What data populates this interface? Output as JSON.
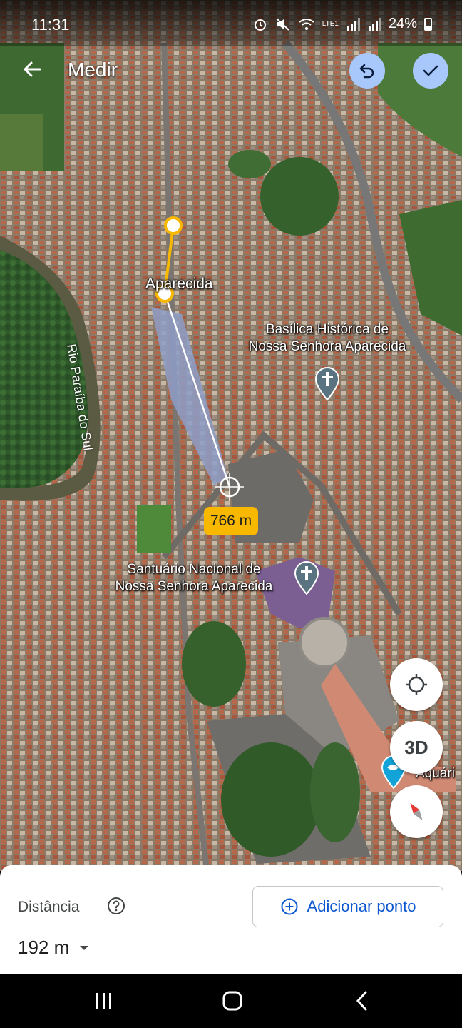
{
  "status_bar": {
    "time": "11:31",
    "battery": "24%",
    "network": "LTE1"
  },
  "app_bar": {
    "title": "Medir",
    "back_icon": "arrow-back-icon",
    "undo_icon": "undo-icon",
    "done_icon": "check-icon"
  },
  "map": {
    "labels": {
      "city": "Aparecida",
      "basilica_line1": "Basílica Histórica de",
      "basilica_line2": "Nossa Senhora Aparecida",
      "santuario_line1": "Santuário Nacional de",
      "santuario_line2": "Nossa Senhora Aparecida",
      "river": "Rio Paraíba do Sul",
      "aquarium": "Aquári"
    },
    "segment_chip": "766 m"
  },
  "fabs": {
    "location_icon": "my-location-icon",
    "three_d": "3D",
    "compass_icon": "compass-icon"
  },
  "sheet": {
    "distance_label": "Distância",
    "distance_value": "192 m",
    "add_point_label": "Adicionar ponto"
  },
  "colors": {
    "accent": "#0b57d0",
    "chip": "#f9b800",
    "button_bg": "#a8c7fa",
    "measure_line": "#f9b800"
  }
}
